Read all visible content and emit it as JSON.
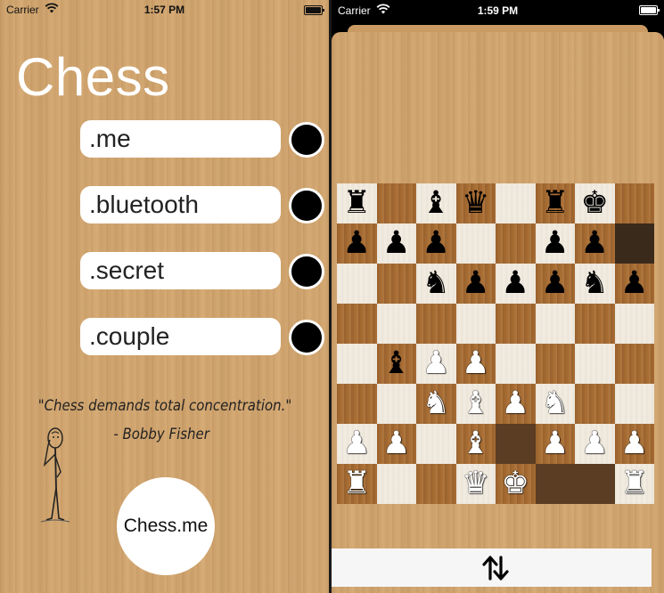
{
  "left_screen": {
    "status": {
      "carrier": "Carrier",
      "time": "1:57 PM"
    },
    "title": "Chess",
    "options": [
      {
        "label": ".me"
      },
      {
        "label": ".bluetooth"
      },
      {
        "label": ".secret"
      },
      {
        "label": ".couple"
      }
    ],
    "quote": "\"Chess demands total concentration.\"",
    "quote_author": "- Bobby Fisher",
    "chessme_button": "Chess.me"
  },
  "right_screen": {
    "status": {
      "carrier": "Carrier",
      "time": "1:59 PM"
    },
    "board": {
      "ranks": [
        [
          "br",
          "",
          "bb",
          "bq",
          "",
          "br",
          "bk",
          ""
        ],
        [
          "bp",
          "bp",
          "bp",
          "",
          "",
          "bp",
          "bp",
          ""
        ],
        [
          "",
          "",
          "bn",
          "bp",
          "bp",
          "bp",
          "bn",
          "bp"
        ],
        [
          "",
          "",
          "",
          "",
          "",
          "",
          "",
          ""
        ],
        [
          "",
          "bb",
          "wp",
          "wp",
          "",
          "",
          "",
          ""
        ],
        [
          "",
          "",
          "wn",
          "wb",
          "wp",
          "wn",
          "",
          ""
        ],
        [
          "wp",
          "wp",
          "",
          "wb",
          "",
          "wp",
          "wp",
          "wp"
        ],
        [
          "wr",
          "",
          "",
          "wq",
          "wk",
          "",
          "",
          "wr"
        ]
      ],
      "highlighted_squares": [
        "h7",
        "e2",
        "f1",
        "g1"
      ]
    },
    "flip_icon": "flip-board-icon"
  }
}
